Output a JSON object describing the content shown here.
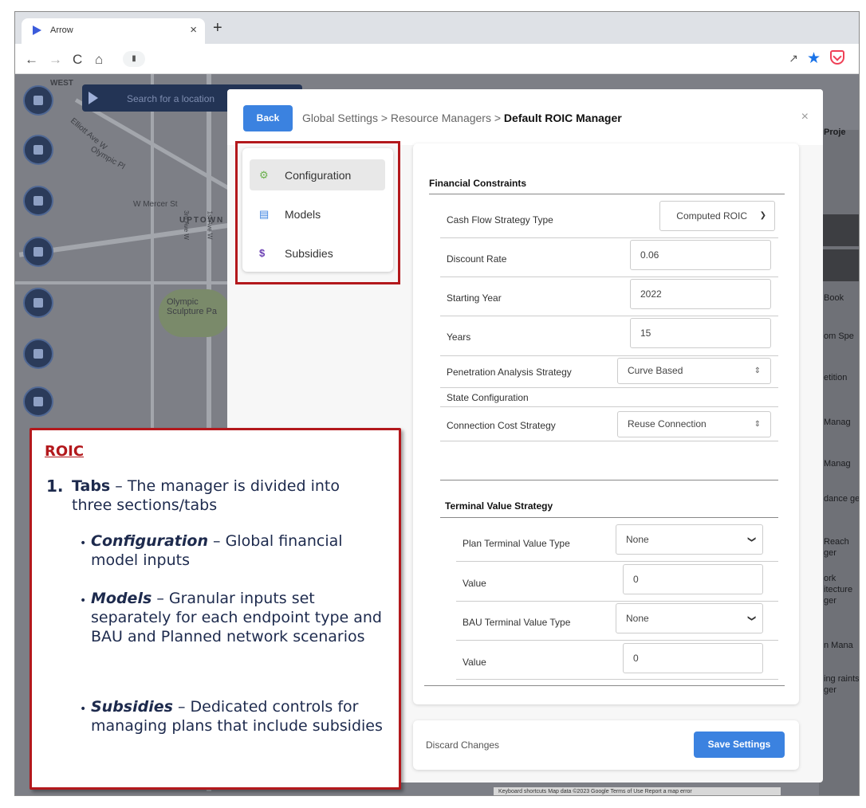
{
  "browser": {
    "tab_title": "Arrow",
    "tab_close": "×",
    "new_tab": "+",
    "nav_back": "←",
    "nav_forward": "→",
    "nav_reload": "C",
    "nav_home": "⌂",
    "lock": "🔒"
  },
  "map": {
    "search_placeholder": "Search for a location",
    "labels": [
      "WEST",
      "Olympic Pl",
      "W Mercer St",
      "UPTOWN",
      "Elliott Ave W",
      "3rd Ave W",
      "1st Ave W",
      "Olympic Sculpture Pa"
    ],
    "right_panel": [
      "Proje",
      "Book",
      "om Spe",
      "etition",
      "Manag",
      "Manag",
      "dance ger",
      "Reach ger",
      "ork itecture ger",
      "n Mana",
      "ing raints ger"
    ],
    "attribution": "Keyboard shortcuts   Map data ©2023 Google   Terms of Use   Report a map error"
  },
  "modal": {
    "back_label": "Back",
    "breadcrumb_prefix": "Global Settings > Resource Managers > ",
    "breadcrumb_current": "Default ROIC Manager",
    "close": "×",
    "tabs": [
      {
        "label": "Configuration",
        "icon": "gear-icon",
        "active": true
      },
      {
        "label": "Models",
        "icon": "database-icon",
        "active": false
      },
      {
        "label": "Subsidies",
        "icon": "dollar-icon",
        "active": false
      }
    ],
    "financial": {
      "title": "Financial Constraints",
      "cash_flow_label": "Cash Flow Strategy Type",
      "cash_flow_value": "Computed ROIC",
      "discount_label": "Discount Rate",
      "discount_value": "0.06",
      "starting_year_label": "Starting Year",
      "starting_year_value": "2022",
      "years_label": "Years",
      "years_value": "15",
      "penetration_label": "Penetration Analysis Strategy",
      "penetration_value": "Curve Based",
      "state_config_label": "State Configuration",
      "connection_label": "Connection Cost Strategy",
      "connection_value": "Reuse Connection"
    },
    "terminal": {
      "title": "Terminal Value Strategy",
      "plan_type_label": "Plan Terminal Value Type",
      "plan_type_value": "None",
      "plan_value_label": "Value",
      "plan_value": "0",
      "bau_type_label": "BAU Terminal Value Type",
      "bau_type_value": "None",
      "bau_value_label": "Value",
      "bau_value": "0"
    },
    "discard_label": "Discard Changes",
    "save_label": "Save Settings"
  },
  "annotation": {
    "title": "ROIC",
    "item_number": "1.",
    "item_title": "Tabs",
    "item_text": " – The manager is divided into three sections/tabs",
    "bullets": [
      {
        "term": "Configuration",
        "text": " – Global financial model inputs"
      },
      {
        "term": "Models",
        "text": " – Granular inputs set separately for each endpoint type and  BAU and Planned network scenarios"
      },
      {
        "term": "Subsidies",
        "text": " – Dedicated controls for managing plans that include subsidies"
      }
    ]
  },
  "colors": {
    "accent": "#3b82e0",
    "highlight": "#b3181c",
    "map_bg": "#7d7f86"
  }
}
